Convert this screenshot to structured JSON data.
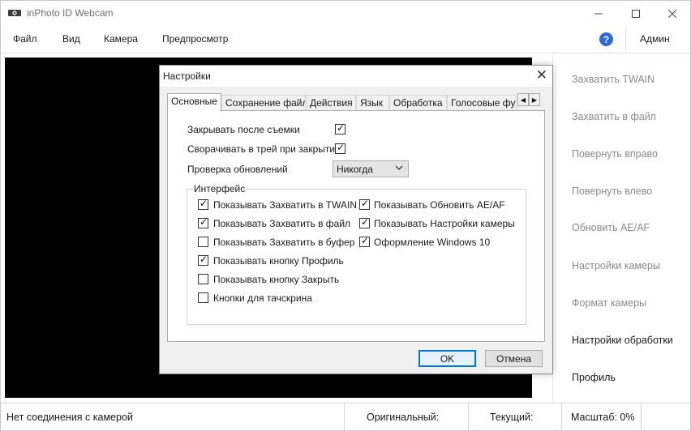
{
  "window": {
    "title": "inPhoto ID Webcam"
  },
  "menu": {
    "items": [
      "Файл",
      "Вид",
      "Камера",
      "Предпросмотр"
    ],
    "user": "Админ"
  },
  "side_actions": [
    {
      "label": "Захватить TWAIN",
      "enabled": false
    },
    {
      "label": "Захватить в файл",
      "enabled": false
    },
    {
      "label": "Повернуть вправо",
      "enabled": false
    },
    {
      "label": "Повернуть влево",
      "enabled": false
    },
    {
      "label": "Обновить AE/AF",
      "enabled": false
    },
    {
      "label": "Настройки камеры",
      "enabled": false
    },
    {
      "label": "Формат камеры",
      "enabled": false
    },
    {
      "label": "Настройки обработки",
      "enabled": true
    },
    {
      "label": "Профиль",
      "enabled": true
    }
  ],
  "status": {
    "connection": "Нет соединения с камерой",
    "original": "Оригинальный:",
    "current": "Текущий:",
    "zoom": "Масштаб: 0%"
  },
  "dialog": {
    "title": "Настройки",
    "tabs": [
      "Основные",
      "Сохранение файла",
      "Действия",
      "Язык",
      "Обработка",
      "Голосовые функции"
    ],
    "selected_tab": "Основные",
    "close_after_capture": {
      "label": "Закрывать после съемки",
      "checked": true
    },
    "minimize_to_tray": {
      "label": "Сворачивать в трей при закрытии",
      "checked": true
    },
    "update_check": {
      "label": "Проверка обновлений",
      "value": "Никогда"
    },
    "interface_group": {
      "legend": "Интерфейс",
      "left": [
        {
          "label": "Показывать Захватить в TWAIN",
          "checked": true
        },
        {
          "label": "Показывать Захватить в файл",
          "checked": true
        },
        {
          "label": "Показывать Захватить в буфер",
          "checked": false
        },
        {
          "label": "Показывать кнопку Профиль",
          "checked": true
        },
        {
          "label": "Показывать кнопку Закрыть",
          "checked": false
        },
        {
          "label": "Кнопки для тачскрина",
          "checked": false
        }
      ],
      "right": [
        {
          "label": "Показывать Обновить AE/AF",
          "checked": true
        },
        {
          "label": "Показывать Настройки камеры",
          "checked": true
        },
        {
          "label": "Оформление Windows 10",
          "checked": true
        }
      ]
    },
    "ok_label": "OK",
    "cancel_label": "Отмена"
  },
  "colors": {
    "accent": "#0078d7",
    "help": "#2a6cd5",
    "video_bg": "#000000"
  }
}
